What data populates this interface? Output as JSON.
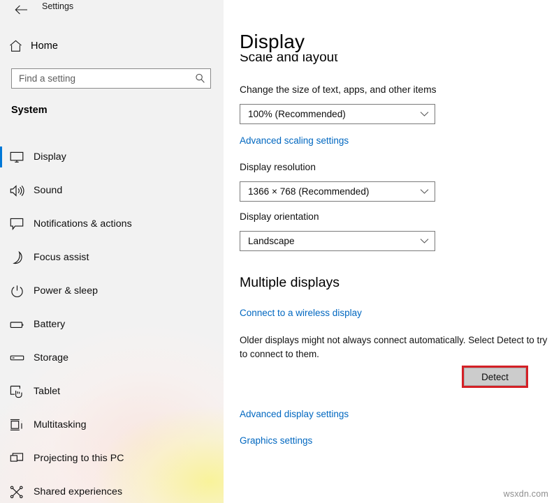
{
  "window": {
    "title": "Settings",
    "back_icon": "back-arrow-icon"
  },
  "sidebar": {
    "home": {
      "label": "Home",
      "icon": "home-icon"
    },
    "search": {
      "placeholder": "Find a setting",
      "value": "",
      "icon": "search-icon"
    },
    "section_title": "System",
    "items": [
      {
        "label": "Display",
        "icon": "monitor-icon",
        "selected": true
      },
      {
        "label": "Sound",
        "icon": "speaker-icon",
        "selected": false
      },
      {
        "label": "Notifications & actions",
        "icon": "speech-bubble-icon",
        "selected": false
      },
      {
        "label": "Focus assist",
        "icon": "moon-icon",
        "selected": false
      },
      {
        "label": "Power & sleep",
        "icon": "power-icon",
        "selected": false
      },
      {
        "label": "Battery",
        "icon": "battery-icon",
        "selected": false
      },
      {
        "label": "Storage",
        "icon": "drive-icon",
        "selected": false
      },
      {
        "label": "Tablet",
        "icon": "tablet-touch-icon",
        "selected": false
      },
      {
        "label": "Multitasking",
        "icon": "multitasking-icon",
        "selected": false
      },
      {
        "label": "Projecting to this PC",
        "icon": "projecting-icon",
        "selected": false
      },
      {
        "label": "Shared experiences",
        "icon": "share-nodes-icon",
        "selected": false
      }
    ],
    "accent_color": "#0078d7"
  },
  "main": {
    "page_title": "Display",
    "scale_and_layout": {
      "heading": "Scale and layout",
      "scale_label": "Change the size of text, apps, and other items",
      "scale_value": "100% (Recommended)",
      "advanced_scaling_link": "Advanced scaling settings",
      "resolution_label": "Display resolution",
      "resolution_value": "1366 × 768 (Recommended)",
      "orientation_label": "Display orientation",
      "orientation_value": "Landscape"
    },
    "multiple_displays": {
      "heading": "Multiple displays",
      "wireless_link": "Connect to a wireless display",
      "helper_text": "Older displays might not always connect automatically. Select Detect to try to connect to them.",
      "detect_button": "Detect",
      "highlight_color": "#d42026"
    },
    "footer_links": {
      "advanced_display": "Advanced display settings",
      "graphics": "Graphics settings"
    }
  },
  "watermark": "wsxdn.com"
}
